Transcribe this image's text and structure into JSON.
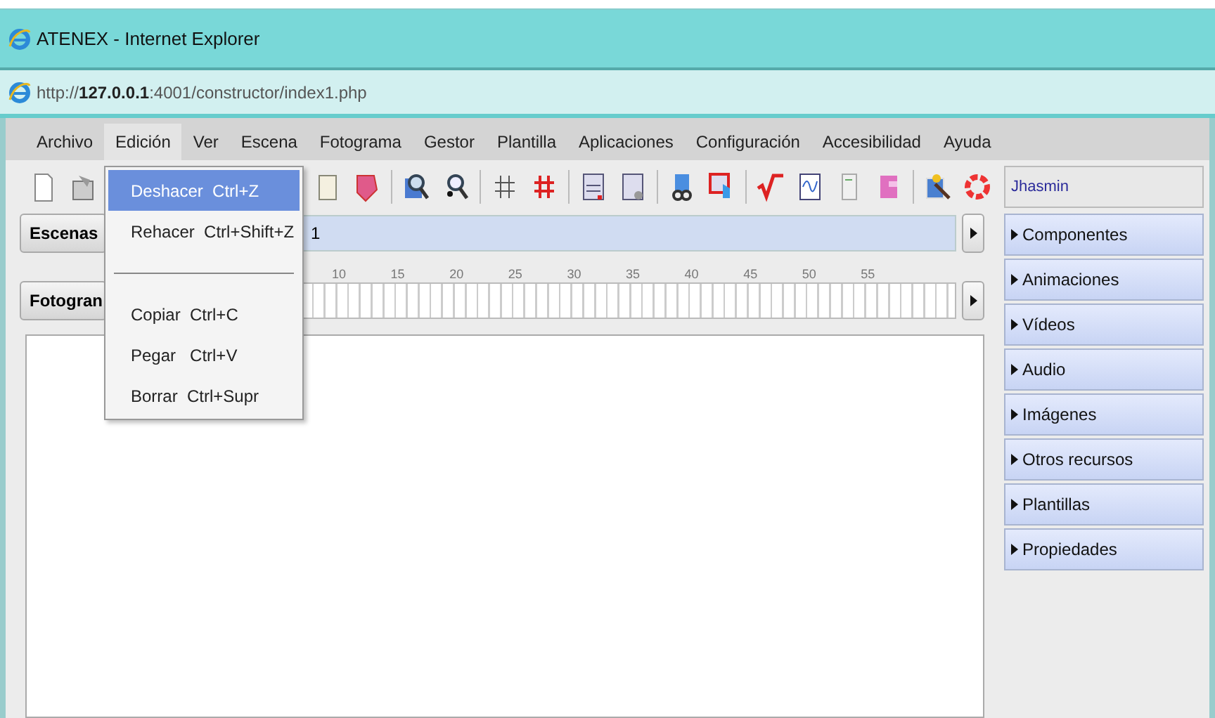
{
  "window": {
    "title": "ATENEX - Internet Explorer"
  },
  "address_bar": {
    "url": "http://**127.0.0.1**:4001/constructor/index1.php"
  },
  "menu": [
    {
      "label": "Archivo",
      "selected": false
    },
    {
      "label": "Edición",
      "selected": true
    },
    {
      "label": "Ver",
      "selected": false
    },
    {
      "label": "Escena",
      "selected": false
    },
    {
      "label": "Fotograma",
      "selected": false
    },
    {
      "label": "Gestor",
      "selected": false
    },
    {
      "label": "Plantilla",
      "selected": false
    },
    {
      "label": "Aplicaciones",
      "selected": false
    },
    {
      "label": "Configuración",
      "selected": false
    },
    {
      "label": "Accesibilidad",
      "selected": false
    },
    {
      "label": "Ayuda",
      "selected": false
    }
  ],
  "dropdown": [
    {
      "kind": "item",
      "label": "Deshacer  Ctrl+Z",
      "selected": true
    },
    {
      "kind": "item",
      "label": "Rehacer  Ctrl+Shift+Z",
      "selected": false
    },
    {
      "kind": "separator"
    },
    {
      "kind": "item",
      "label": "Copiar  Ctrl+C",
      "selected": false
    },
    {
      "kind": "item",
      "label": "Pegar   Ctrl+V",
      "selected": false
    },
    {
      "kind": "item",
      "label": "Borrar  Ctrl+Supr",
      "selected": false
    }
  ],
  "timeline": {
    "scenes_label": "Escenas",
    "scene_tab": "1",
    "frames_label": "Fotogran",
    "ruler": [
      "10",
      "15",
      "20",
      "25",
      "30",
      "35",
      "40",
      "45",
      "50",
      "55"
    ]
  },
  "user": {
    "name": "Jhasmin"
  },
  "panels": [
    {
      "label": "Componentes",
      "expanded": false
    },
    {
      "label": "Animaciones",
      "expanded": false
    },
    {
      "label": "Vídeos",
      "expanded": false
    },
    {
      "label": "Audio",
      "expanded": false
    },
    {
      "label": "Imágenes",
      "expanded": false
    },
    {
      "label": "Otros recursos",
      "expanded": false
    },
    {
      "label": "Plantillas",
      "expanded": false
    },
    {
      "label": "Propiedades",
      "expanded": false
    }
  ]
}
